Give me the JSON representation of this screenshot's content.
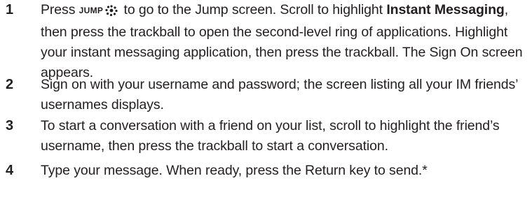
{
  "steps": [
    {
      "number": "1",
      "pre_key": "Press ",
      "key_label": "JUMP",
      "key_icon": "dots-circle-icon",
      "post_key": " to go to the Jump screen. Scroll to highlight ",
      "bold_term": "Instant Messaging",
      "rest": ", then press the trackball to open the second-level ring of applications. Highlight your instant messaging application, then press the trackball. The Sign On screen appears."
    },
    {
      "number": "2",
      "text": "Sign on with your username and password; the screen listing all your IM friends’ usernames displays."
    },
    {
      "number": "3",
      "text": "To start a conversation with a friend on your list, scroll to highlight the friend’s username, then press the trackball to start a conversation."
    },
    {
      "number": "4",
      "text": "Type your message. When ready, press the Return key to send.*"
    }
  ]
}
